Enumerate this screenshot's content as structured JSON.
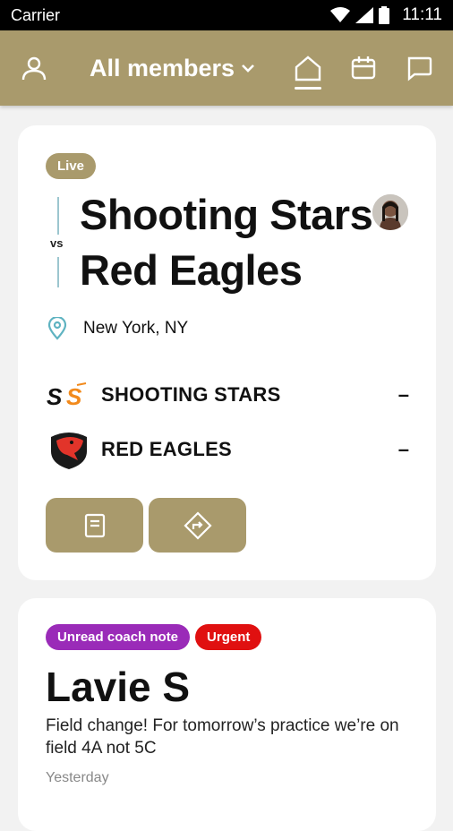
{
  "status_bar": {
    "carrier": "Carrier",
    "time": "11:11"
  },
  "app_bar": {
    "title": "All members",
    "icons": [
      "profile-icon",
      "chevron-down-icon",
      "home-icon",
      "calendar-icon",
      "chat-icon"
    ]
  },
  "game": {
    "status": "Live",
    "vs_label": "vs",
    "home_team": "Shooting Stars",
    "away_team": "Red Eagles",
    "location": "New York, NY",
    "teams": [
      {
        "name": "SHOOTING STARS",
        "score": "–"
      },
      {
        "name": "RED EAGLES",
        "score": "–"
      }
    ],
    "action_icons": [
      "document-icon",
      "directions-icon"
    ]
  },
  "note": {
    "badges": [
      "Unread coach note",
      "Urgent"
    ],
    "author": "Lavie S",
    "body": "Field change! For tomorrow’s practice we’re on field 4A not 5C",
    "time": "Yesterday"
  },
  "colors": {
    "brand": "#a99a6c",
    "unread": "#9a2bb8",
    "urgent": "#e01010",
    "accent_line": "#9cc6cf"
  }
}
